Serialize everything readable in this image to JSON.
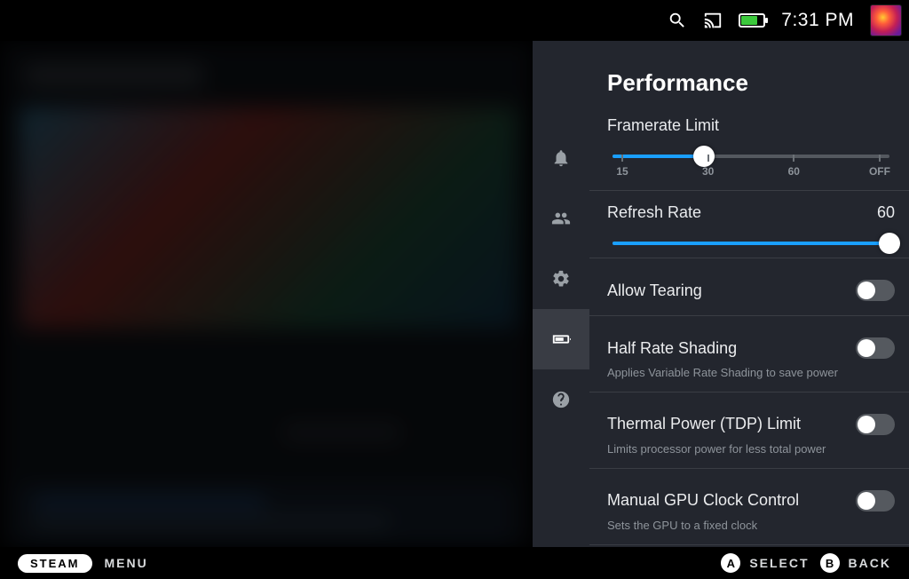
{
  "topbar": {
    "clock": "7:31 PM"
  },
  "panel": {
    "title": "Performance",
    "framerate": {
      "label": "Framerate Limit",
      "ticks": [
        "15",
        "30",
        "60",
        "OFF"
      ],
      "fill_pct": 33,
      "handle_pct": 33
    },
    "refresh": {
      "label": "Refresh Rate",
      "value": "60",
      "fill_pct": 100,
      "handle_pct": 100
    },
    "tearing": {
      "label": "Allow Tearing"
    },
    "halfrate": {
      "label": "Half Rate Shading",
      "subtext": "Applies Variable Rate Shading to save power"
    },
    "tdp": {
      "label": "Thermal Power (TDP) Limit",
      "subtext": "Limits processor power for less total power"
    },
    "gpu": {
      "label": "Manual GPU Clock Control",
      "subtext": "Sets the GPU to a fixed clock"
    }
  },
  "footer": {
    "steam": "STEAM",
    "menu": "MENU",
    "a": {
      "glyph": "A",
      "label": "SELECT"
    },
    "b": {
      "glyph": "B",
      "label": "BACK"
    }
  }
}
